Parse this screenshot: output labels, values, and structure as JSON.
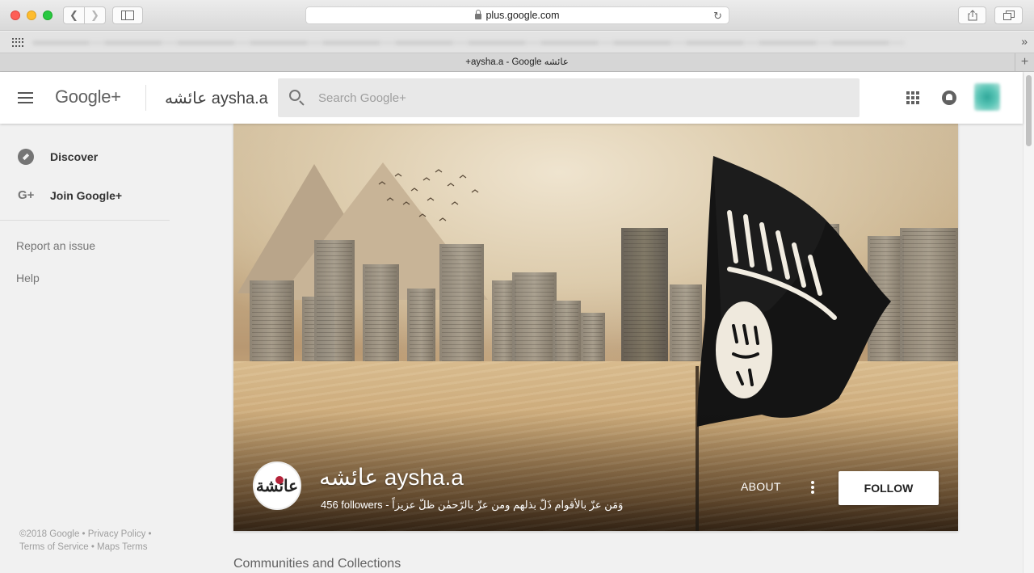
{
  "browser": {
    "url": "plus.google.com",
    "tab_title": "+aysha.a - Google عائشه"
  },
  "header": {
    "logo": "Google+",
    "profile_name": "عائشه aysha.a",
    "search_placeholder": "Search Google+"
  },
  "leftnav": {
    "items": [
      {
        "label": "Discover",
        "icon": "compass-icon"
      },
      {
        "label": "Join Google+",
        "icon": "google-plus-icon"
      }
    ],
    "links": [
      "Report an issue",
      "Help"
    ],
    "footer": "©2018 Google • Privacy Policy • Terms of Service • Maps Terms"
  },
  "profile": {
    "display_name": "عائشه aysha.a",
    "avatar_text": "عائشة",
    "followers": "456 followers",
    "tagline": "وَمَن عزّ بالأقوام ذَلّ بذلهم ومن عزّ بالرّحمٰن ظلّ عزيزاً",
    "meta_separator": " - ",
    "about_label": "ABOUT",
    "follow_label": "FOLLOW"
  },
  "sections": {
    "communities_title": "Communities and Collections"
  }
}
